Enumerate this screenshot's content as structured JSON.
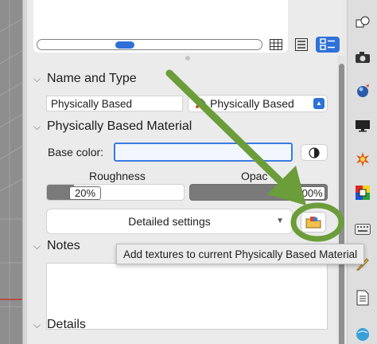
{
  "name_and_type": {
    "heading": "Name and Type",
    "name_value": "Physically Based",
    "type_selected": "Physically Based"
  },
  "pbm": {
    "heading": "Physically Based Material",
    "base_color_label": "Base color:",
    "roughness_label": "Roughness",
    "roughness_value": "20%",
    "roughness_fraction": 0.2,
    "opacity_label": "Opac",
    "opacity_value": "100%",
    "opacity_fraction": 1.0,
    "detailed_settings_label": "Detailed settings"
  },
  "tooltip": "Add textures to current Physically Based Material",
  "notes": {
    "heading": "Notes",
    "value": ""
  },
  "details": {
    "heading": "Details"
  },
  "preview": {
    "size_fraction": 0.38
  },
  "view_modes": [
    "grid-view-icon",
    "list-view-icon",
    "detail-view-icon"
  ],
  "toolbar_icons": [
    "objects-icon",
    "camera-icon",
    "material-sphere-icon",
    "display-icon",
    "sun-icon",
    "color-swatch-icon",
    "keyboard-icon",
    "document-icon",
    "globe-icon"
  ],
  "colors": {
    "accent": "#2f72d6",
    "annotation_green": "#6b9d3a",
    "panel_bg": "#ebebeb"
  }
}
